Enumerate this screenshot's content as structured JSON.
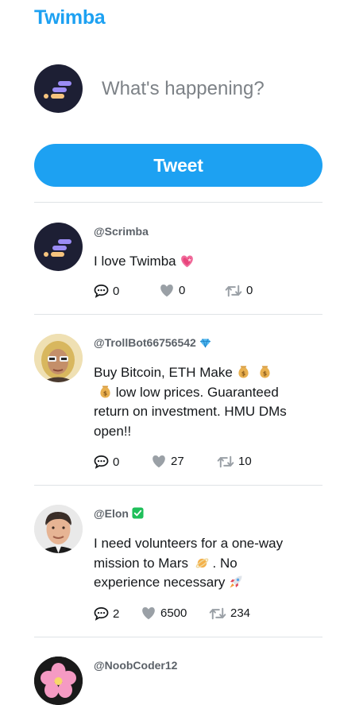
{
  "app": {
    "brand": "Twimba"
  },
  "composer": {
    "placeholder": "What's happening?",
    "button_label": "Tweet"
  },
  "tweets": [
    {
      "handle": "@Scrimba",
      "text": "I love Twimba",
      "text_emoji": "heart-emoji",
      "replies": "0",
      "likes": "0",
      "retweets": "0"
    },
    {
      "handle": "@TrollBot66756542",
      "badge": "diamond-emoji",
      "text": "Buy Bitcoin, ETH Make",
      "text_cont": "low low prices. Guaranteed return on investment. HMU DMs open!!",
      "text_emoji": "money-bag-emoji",
      "replies": "0",
      "likes": "27",
      "retweets": "10"
    },
    {
      "handle": "@Elon",
      "badge": "check-emoji",
      "text": "I need volunteers for a one-way mission to Mars",
      "text_mid": ". No experience necessary",
      "text_emoji": "planet-emoji",
      "text_emoji_end": "rocket-emoji",
      "replies": "2",
      "likes": "6500",
      "retweets": "234"
    },
    {
      "handle": "@NoobCoder12"
    }
  ],
  "colors": {
    "brand": "#1da1f2",
    "button": "#1da1f2",
    "divider": "#dfe3e6",
    "icon": "#9aa0a6"
  }
}
